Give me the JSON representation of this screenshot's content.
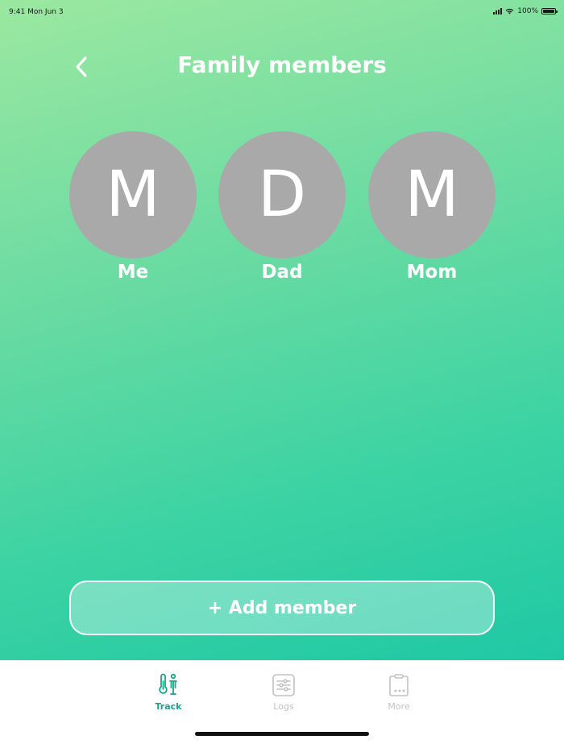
{
  "status_bar": {
    "time": "9:41",
    "date": "Mon Jun 3",
    "battery": "100%"
  },
  "header": {
    "title": "Family members",
    "back_icon": "chevron-left-icon"
  },
  "members": [
    {
      "initial": "M",
      "name": "Me"
    },
    {
      "initial": "D",
      "name": "Dad"
    },
    {
      "initial": "M",
      "name": "Mom"
    }
  ],
  "add_button": {
    "label": "+ Add member"
  },
  "tabs": [
    {
      "label": "Track",
      "icon": "thermometer-person-icon",
      "active": true
    },
    {
      "label": "Logs",
      "icon": "sliders-icon",
      "active": false
    },
    {
      "label": "More",
      "icon": "clipboard-icon",
      "active": false
    }
  ],
  "colors": {
    "gradient_top": "#9be8a0",
    "gradient_bottom": "#1fc8a4",
    "avatar": "#a9a9a9",
    "active_tab": "#17a589",
    "inactive_tab": "#c2c2c2"
  }
}
